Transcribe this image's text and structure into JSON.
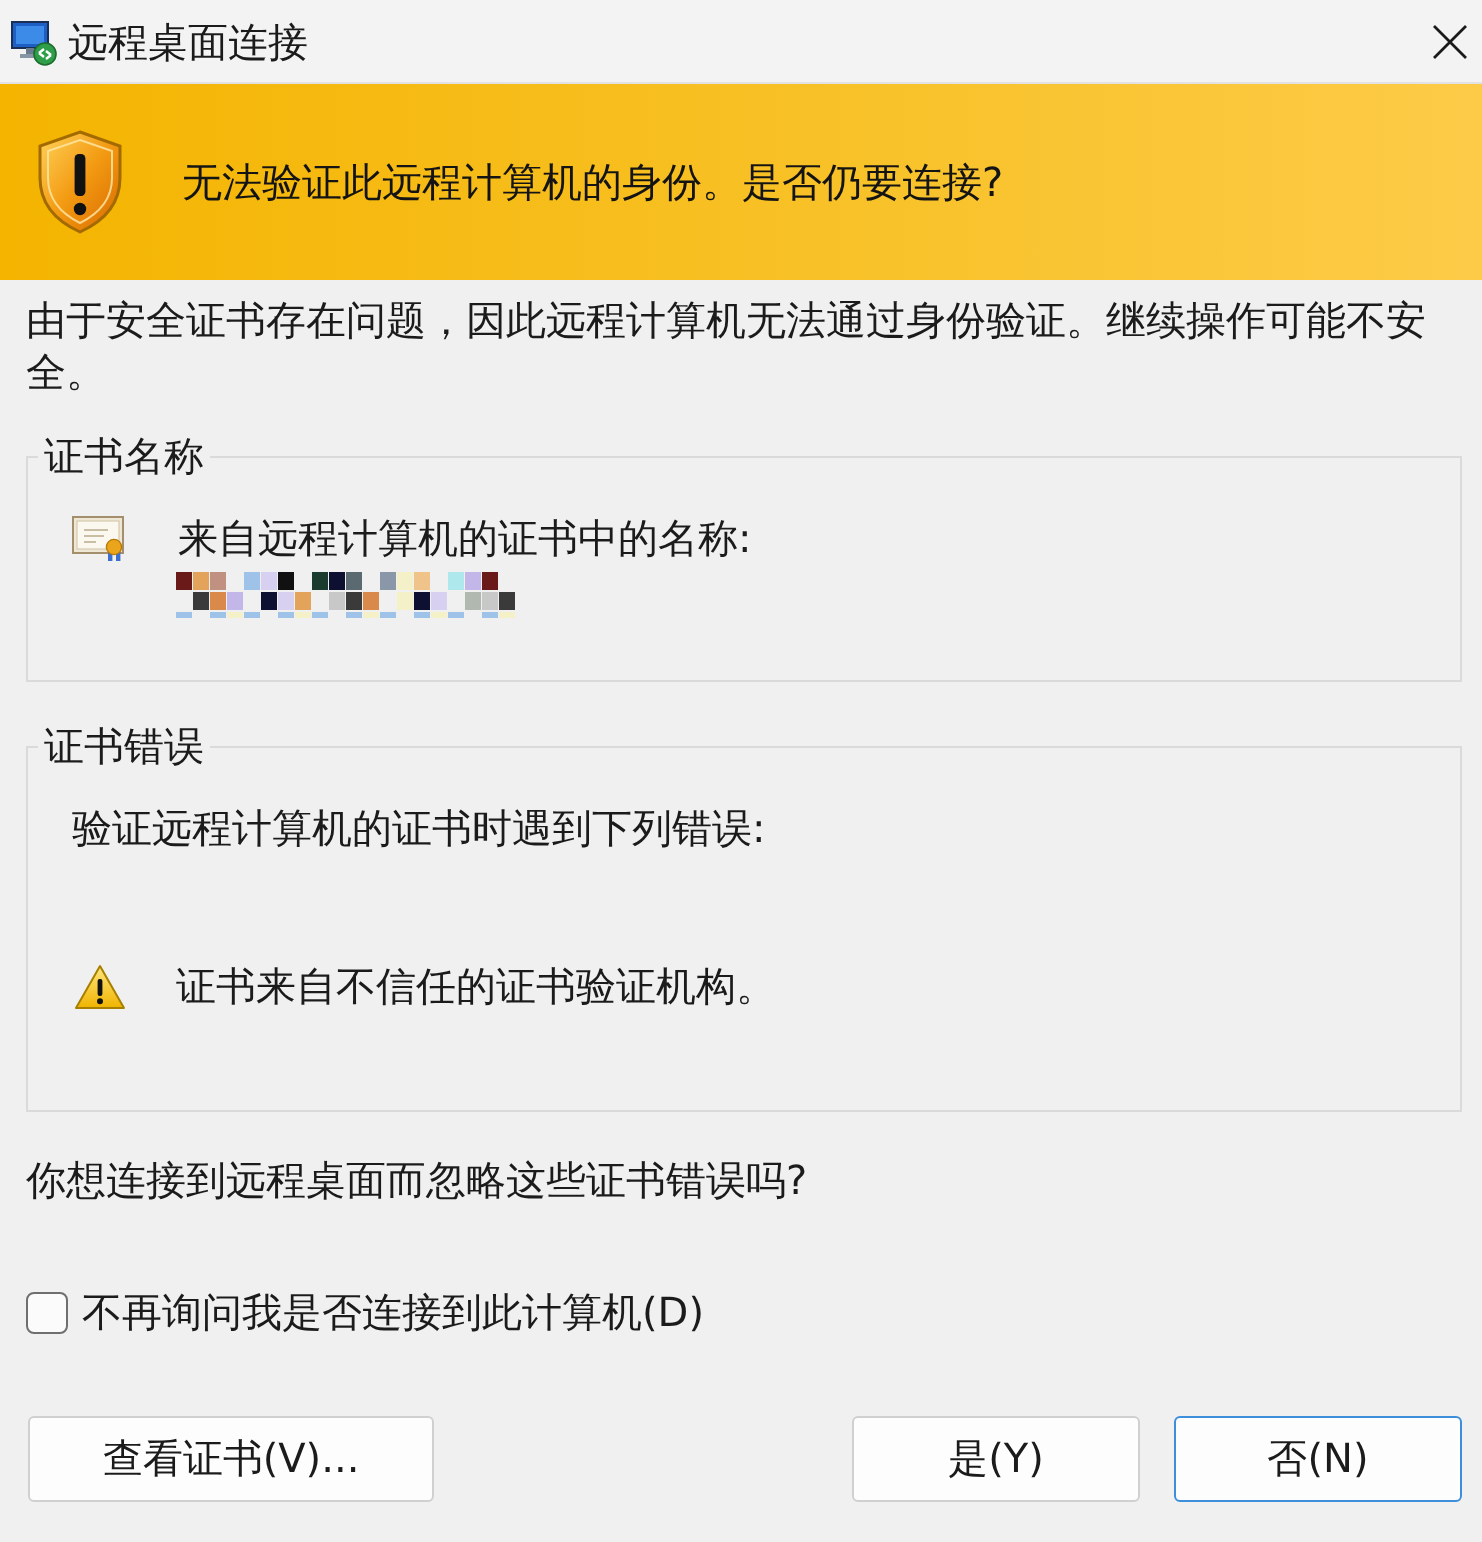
{
  "window": {
    "title": "远程桌面连接"
  },
  "banner": {
    "message": "无法验证此远程计算机的身份。是否仍要连接?"
  },
  "description": "由于安全证书存在问题，因此远程计算机无法通过身份验证。继续操作可能不安全。",
  "certificate_name": {
    "title": "证书名称",
    "label": "来自远程计算机的证书中的名称:"
  },
  "certificate_errors": {
    "title": "证书错误",
    "intro": "验证远程计算机的证书时遇到下列错误:",
    "errors": [
      {
        "kind": "warning",
        "text": "证书来自不信任的证书验证机构。"
      }
    ]
  },
  "question": "你想连接到远程桌面而忽略这些证书错误吗?",
  "checkbox": {
    "label": "不再询问我是否连接到此计算机(D)",
    "checked": false
  },
  "buttons": [
    {
      "label": "查看证书(V)...",
      "default": false
    },
    {
      "label": "是(Y)",
      "default": false
    },
    {
      "label": "否(N)",
      "default": true
    }
  ]
}
